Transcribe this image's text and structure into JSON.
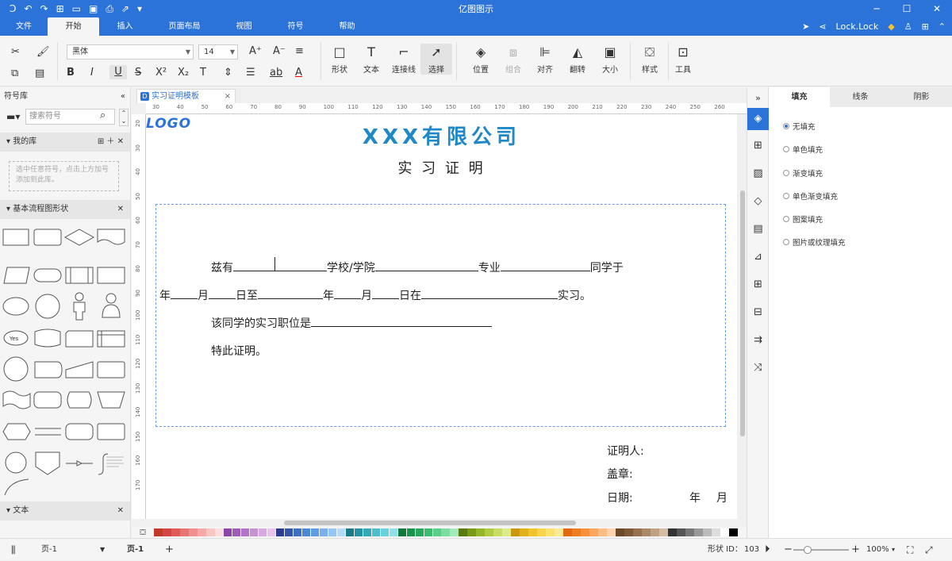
{
  "app": {
    "title": "亿图图示"
  },
  "menu": {
    "file": "文件",
    "tabs": [
      "开始",
      "插入",
      "页面布局",
      "视图",
      "符号",
      "帮助"
    ],
    "active_tab": "开始",
    "user": "Lock.Lock"
  },
  "ribbon": {
    "font_name": "黑体",
    "font_size": "14",
    "groups": [
      {
        "label": "形状",
        "icon": "rect-shape-icon"
      },
      {
        "label": "文本",
        "icon": "text-icon"
      },
      {
        "label": "连接线",
        "icon": "connector-icon"
      },
      {
        "label": "选择",
        "icon": "pointer-icon"
      },
      {
        "label": "位置",
        "icon": "layers-icon"
      },
      {
        "label": "组合",
        "icon": "group-icon"
      },
      {
        "label": "对齐",
        "icon": "align-icon"
      },
      {
        "label": "翻转",
        "icon": "flip-icon"
      },
      {
        "label": "大小",
        "icon": "size-icon"
      },
      {
        "label": "样式",
        "icon": "fill-bucket-icon"
      },
      {
        "label": "工具",
        "icon": "tools-icon"
      }
    ]
  },
  "left_panel": {
    "title": "符号库",
    "search_placeholder": "搜索符号",
    "my_library": {
      "title": "我的库",
      "hint": "选中任意符号，点击上方加号添加到此库。"
    },
    "basic_flow": {
      "title": "基本流程图形状",
      "yes_label": "Yes"
    },
    "text_section": {
      "title": "文本"
    }
  },
  "document": {
    "tab_name": "实习证明模板",
    "logo": "LOGO",
    "company": "XXX有限公司",
    "doc_title": "实 习 证 明",
    "line1": {
      "a": "兹有",
      "b": "学校/学院",
      "c": "专业",
      "d": "同学于"
    },
    "line2": {
      "a": "年",
      "b": "月",
      "c": "日至",
      "d": "年",
      "e": "月",
      "f": "日在",
      "g": "实习。"
    },
    "line3": "该同学的实习职位是",
    "line4": "特此证明。",
    "sig_person": "证明人:",
    "sig_stamp": "盖章:",
    "sig_date": "日期:",
    "sig_year": "年",
    "sig_month": "月"
  },
  "ruler": {
    "h_ticks": [
      "30",
      "40",
      "50",
      "60",
      "70",
      "80",
      "90",
      "100",
      "110",
      "120",
      "130",
      "140",
      "150",
      "160",
      "170",
      "180",
      "190",
      "200",
      "210",
      "220",
      "230",
      "240",
      "250",
      "260"
    ],
    "v_ticks": [
      "20",
      "30",
      "40",
      "50",
      "60",
      "70",
      "80",
      "90",
      "100",
      "110",
      "120",
      "130",
      "140",
      "150",
      "160",
      "170"
    ]
  },
  "right_panel": {
    "tabs": [
      "填充",
      "线条",
      "阴影"
    ],
    "active_tab": "填充",
    "fill_options": [
      "无填充",
      "单色填充",
      "渐变填充",
      "单色渐变填充",
      "图案填充",
      "图片或纹理填充"
    ],
    "selected_fill": "无填充"
  },
  "status": {
    "page_selector": "页-1",
    "page_tab": "页-1",
    "add_page": "+",
    "shape_id_label": "形状 ID：",
    "shape_id": "103",
    "zoom": "100%"
  },
  "palette_colors": [
    "#c0392b",
    "#d64545",
    "#e05a5a",
    "#e87474",
    "#ef8f8f",
    "#f5a9a9",
    "#f9c4c4",
    "#fcdede",
    "#8e44ad",
    "#a05ab8",
    "#b474c8",
    "#c68fd6",
    "#d8a9e3",
    "#e9c4ef",
    "#2c3e91",
    "#3455a8",
    "#3f6fc0",
    "#4d86d4",
    "#5f9ce3",
    "#78b1ee",
    "#96c6f5",
    "#b6daf9",
    "#1a7a8a",
    "#2593a3",
    "#33a9b9",
    "#4bbfcd",
    "#6ad1dc",
    "#8fe0e8",
    "#0f7a3a",
    "#1a944a",
    "#28a85c",
    "#3dbd70",
    "#5acf88",
    "#7edea2",
    "#a3ebbd",
    "#5a7a0f",
    "#78991a",
    "#95b52b",
    "#b0cc45",
    "#c8de66",
    "#dcec8c",
    "#c99a0f",
    "#e0b11a",
    "#f0c52b",
    "#f7d54a",
    "#fae06f",
    "#fcea97",
    "#e06a0f",
    "#ee7d1f",
    "#f7923a",
    "#fba75d",
    "#fdbd85",
    "#fed3ad",
    "#6b4a2b",
    "#80593a",
    "#96704f",
    "#ab8866",
    "#c1a183",
    "#d6bca3",
    "#333333",
    "#555555",
    "#777777",
    "#999999",
    "#bbbbbb",
    "#dddddd",
    "#ffffff",
    "#000000"
  ]
}
